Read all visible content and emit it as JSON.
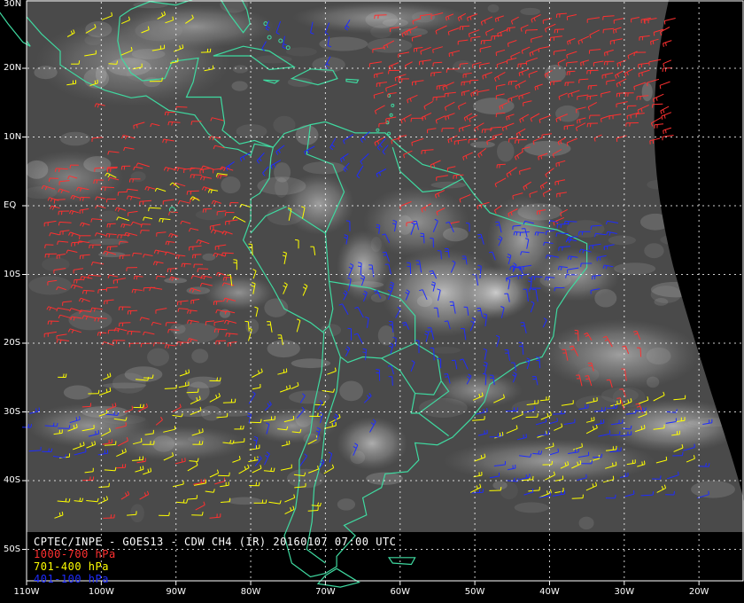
{
  "product_title": "CPTEC/INPE - GOES13 - CDW CH4 (IR) 20160107 07:00 UTC",
  "legend": [
    {
      "label": "1000-700 hPa",
      "color": "#ff3030"
    },
    {
      "label": "701-400 hPa",
      "color": "#ffff00"
    },
    {
      "label": "401-100 hPa",
      "color": "#1e2cff"
    }
  ],
  "latitude_labels": [
    {
      "text": "30N",
      "lat": 30
    },
    {
      "text": "20N",
      "lat": 20
    },
    {
      "text": "10N",
      "lat": 10
    },
    {
      "text": "EQ",
      "lat": 0
    },
    {
      "text": "10S",
      "lat": -10
    },
    {
      "text": "20S",
      "lat": -20
    },
    {
      "text": "30S",
      "lat": -30
    },
    {
      "text": "40S",
      "lat": -40
    },
    {
      "text": "50S",
      "lat": -50
    }
  ],
  "longitude_labels": [
    {
      "text": "110W",
      "lon": -110
    },
    {
      "text": "100W",
      "lon": -100
    },
    {
      "text": "90W",
      "lon": -90
    },
    {
      "text": "80W",
      "lon": -80
    },
    {
      "text": "70W",
      "lon": -70
    },
    {
      "text": "60W",
      "lon": -60
    },
    {
      "text": "50W",
      "lon": -50
    },
    {
      "text": "40W",
      "lon": -40
    },
    {
      "text": "30W",
      "lon": -30
    },
    {
      "text": "20W",
      "lon": -20
    }
  ],
  "map": {
    "lon_range": [
      -110,
      -15
    ],
    "lat_range": [
      -55,
      30
    ],
    "coastline_color": "#3fd9a0",
    "grid_color": "#ffffff"
  }
}
